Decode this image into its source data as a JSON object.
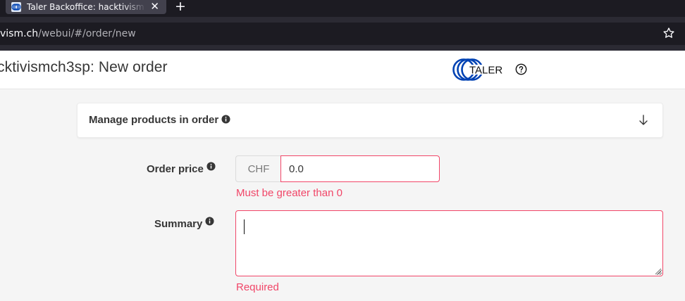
{
  "browser": {
    "tab_title": "Taler Backoffice: hacktivism",
    "url_host": "vism.ch",
    "url_path": "/webui/#/order/new"
  },
  "header": {
    "title": "cktivismch3sp: New order",
    "logo_text": "TALER"
  },
  "products_card": {
    "title": "Manage products in order"
  },
  "form": {
    "price_label": "Order price",
    "currency": "CHF",
    "price_value": "0.0",
    "price_error": "Must be greater than 0",
    "summary_label": "Summary",
    "summary_value": "",
    "summary_error": "Required"
  },
  "colors": {
    "danger": "#f14668",
    "logo_blue": "#0042b3"
  }
}
